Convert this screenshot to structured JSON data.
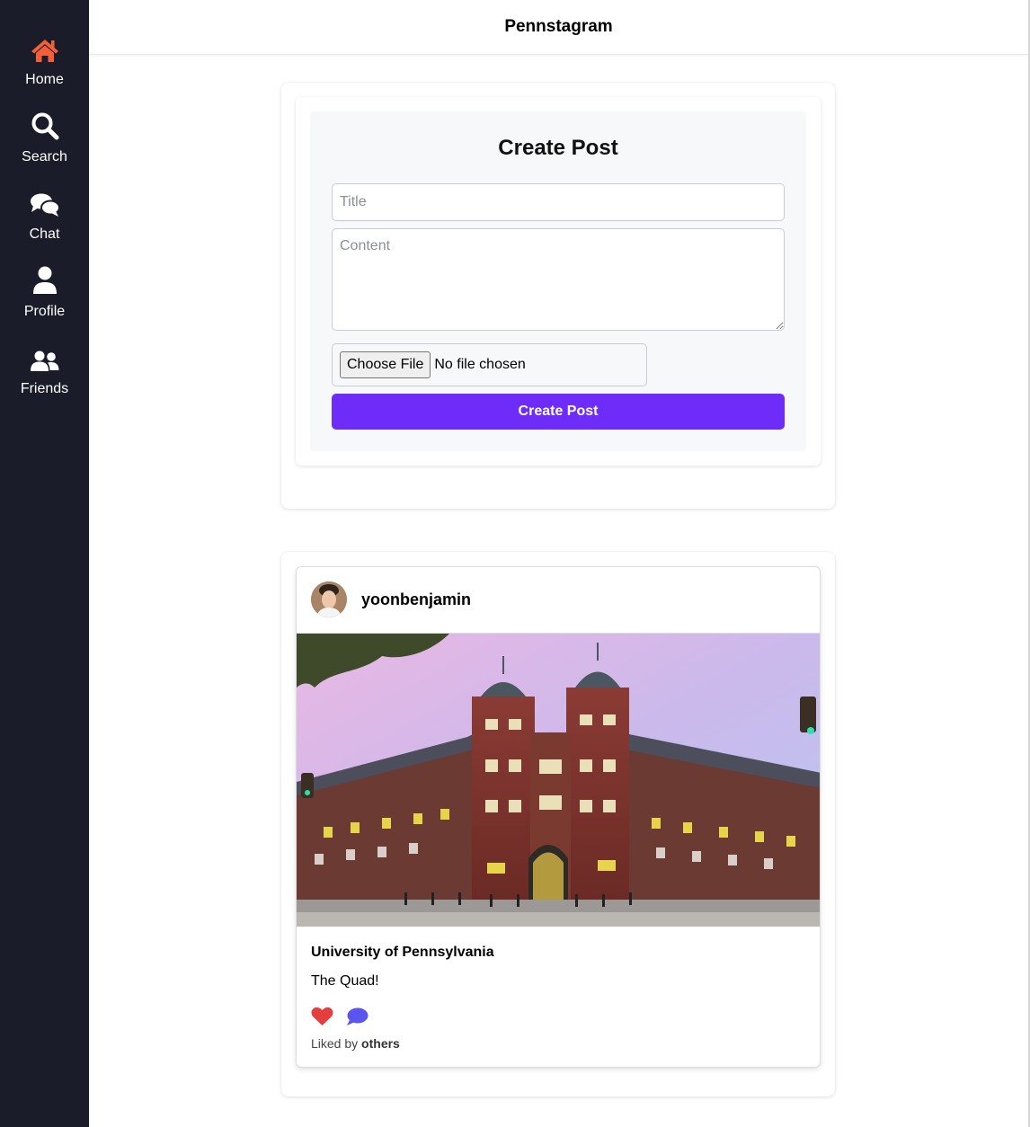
{
  "app": {
    "title": "Pennstagram"
  },
  "sidebar": {
    "items": [
      {
        "label": "Home",
        "icon": "home-icon",
        "active": true
      },
      {
        "label": "Search",
        "icon": "search-icon"
      },
      {
        "label": "Chat",
        "icon": "chat-icon"
      },
      {
        "label": "Profile",
        "icon": "user-icon"
      },
      {
        "label": "Friends",
        "icon": "users-icon"
      }
    ],
    "active_color": "#f0603a"
  },
  "create_post": {
    "heading": "Create Post",
    "title_placeholder": "Title",
    "content_placeholder": "Content",
    "file_button_label": "Choose File",
    "file_status": "No file chosen",
    "submit_label": "Create Post",
    "accent_color": "#6d2cf8"
  },
  "post": {
    "username": "yoonbenjamin",
    "title": "University of Pennsylvania",
    "body": "The Quad!",
    "liked_by_prefix": "Liked by",
    "liked_by_name": "others",
    "like_color": "#e53e3e",
    "comment_color": "#5b55f0"
  }
}
